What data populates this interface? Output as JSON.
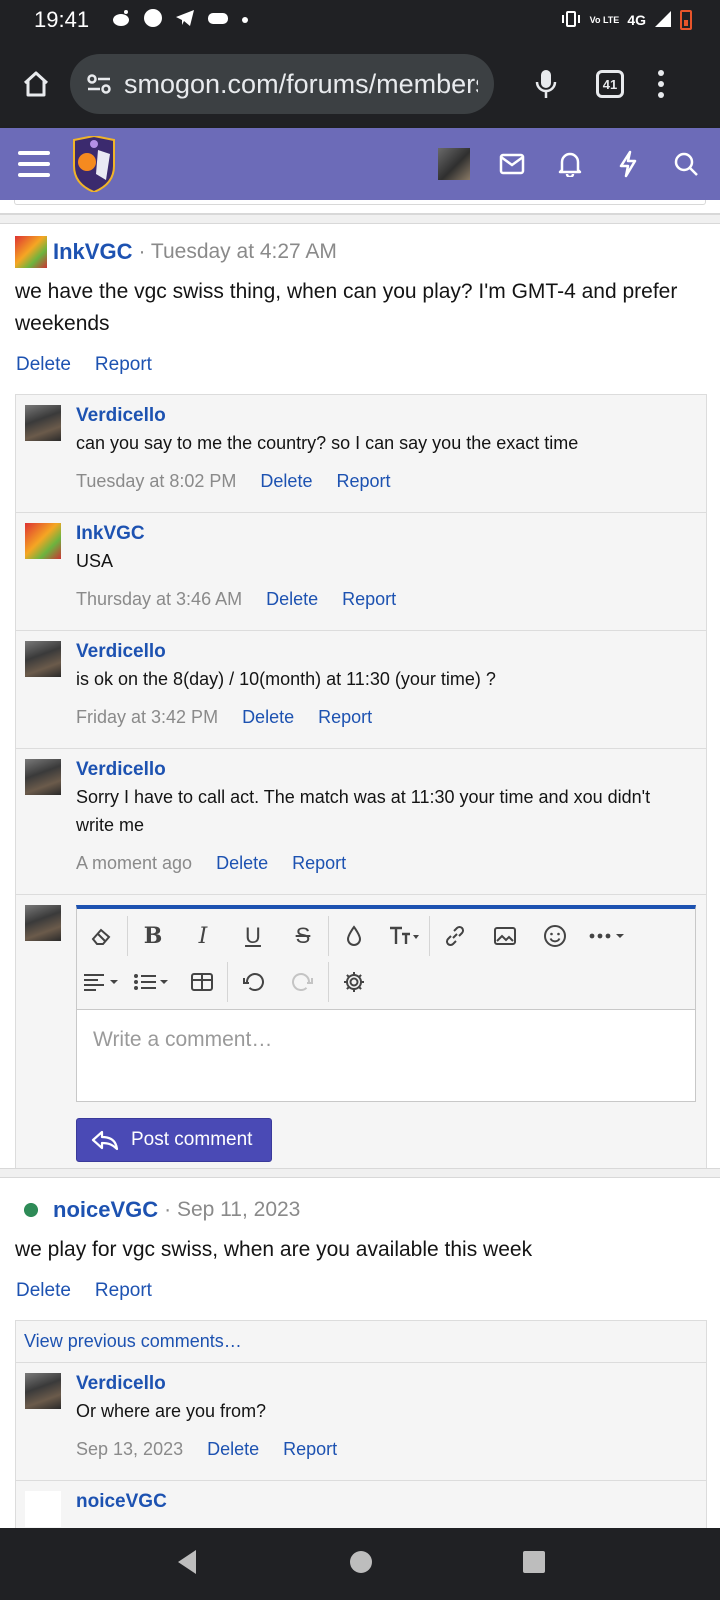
{
  "status_bar": {
    "time": "19:41",
    "network": "4G",
    "lte": "Vo LTE"
  },
  "browser": {
    "url": "smogon.com/forums/members",
    "tab_count": "41"
  },
  "posts": [
    {
      "author": "InkVGC",
      "date": "· Tuesday at 4:27 AM",
      "body": "we have the vgc swiss thing, when can you play? I'm GMT-4 and prefer weekends",
      "delete_label": "Delete",
      "report_label": "Report",
      "comments": [
        {
          "author": "Verdicello",
          "body": "can you say to me the country? so I can say you the exact time",
          "time": "Tuesday at 8:02 PM",
          "delete_label": "Delete",
          "report_label": "Report"
        },
        {
          "author": "InkVGC",
          "body": "USA",
          "time": "Thursday at 3:46 AM",
          "delete_label": "Delete",
          "report_label": "Report"
        },
        {
          "author": "Verdicello",
          "body": "is ok on the 8(day) / 10(month) at 11:30 (your time) ?",
          "time": "Friday at 3:42 PM",
          "delete_label": "Delete",
          "report_label": "Report"
        },
        {
          "author": "Verdicello",
          "body": "Sorry I have to call act. The match was at 11:30 your time and xou didn't write me",
          "time": "A moment ago",
          "delete_label": "Delete",
          "report_label": "Report"
        }
      ],
      "editor": {
        "placeholder": "Write a comment…",
        "submit_label": "Post comment"
      }
    },
    {
      "author": "noiceVGC",
      "date": "· Sep 11, 2023",
      "body": "we play for vgc swiss, when are you available this week",
      "delete_label": "Delete",
      "report_label": "Report",
      "view_previous_label": "View previous comments…",
      "comments": [
        {
          "author": "Verdicello",
          "body": "Or where are you from?",
          "time": "Sep 13, 2023",
          "delete_label": "Delete",
          "report_label": "Report"
        },
        {
          "author": "noiceVGC"
        }
      ]
    }
  ],
  "colors": {
    "header": "#6c6bb8",
    "link": "#1d52b1",
    "button": "#4a4ab5"
  }
}
